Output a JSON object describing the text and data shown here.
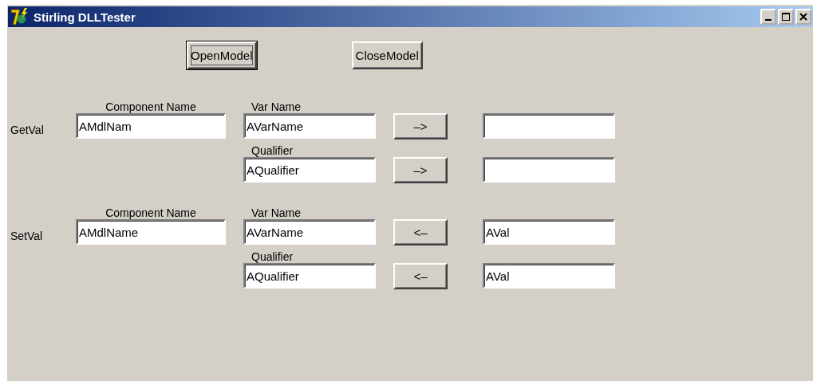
{
  "window": {
    "title": "Stirling DLLTester"
  },
  "top_buttons": [
    {
      "label": "OpenModel",
      "focused": true
    },
    {
      "label": "CloseModel",
      "focused": false
    }
  ],
  "sections": [
    {
      "label": "GetVal",
      "component_label": "Component Name",
      "component_value": "AMdlNam",
      "rows": [
        {
          "label": "Var Name",
          "value": "AVarName",
          "arrow": "–>",
          "result": ""
        },
        {
          "label": "Qualifier",
          "value": "AQualifier",
          "arrow": "–>",
          "result": ""
        }
      ]
    },
    {
      "label": "SetVal",
      "component_label": "Component Name",
      "component_value": "AMdlName",
      "rows": [
        {
          "label": "Var Name",
          "value": "AVarName",
          "arrow": "<–",
          "result": "AVal"
        },
        {
          "label": "Qualifier",
          "value": "AQualifier",
          "arrow": "<–",
          "result": "AVal"
        }
      ]
    }
  ]
}
